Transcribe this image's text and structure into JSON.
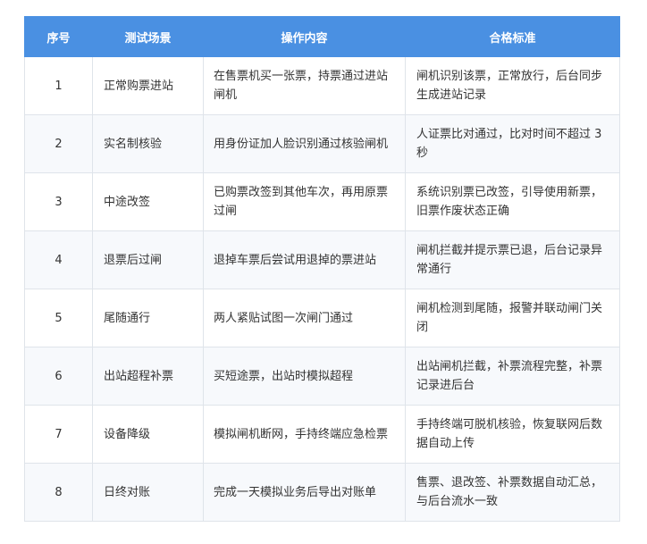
{
  "headers": [
    "序号",
    "测试场景",
    "操作内容",
    "合格标准"
  ],
  "rows": [
    {
      "no": "1",
      "scene": "正常购票进站",
      "op": "在售票机买一张票，持票通过进站闸机",
      "std": "闸机识别该票，正常放行，后台同步生成进站记录"
    },
    {
      "no": "2",
      "scene": "实名制核验",
      "op": "用身份证加人脸识别通过核验闸机",
      "std": "人证票比对通过，比对时间不超过 3 秒"
    },
    {
      "no": "3",
      "scene": "中途改签",
      "op": "已购票改签到其他车次，再用原票过闸",
      "std": "系统识别票已改签，引导使用新票，旧票作废状态正确"
    },
    {
      "no": "4",
      "scene": "退票后过闸",
      "op": "退掉车票后尝试用退掉的票进站",
      "std": "闸机拦截并提示票已退，后台记录异常通行"
    },
    {
      "no": "5",
      "scene": "尾随通行",
      "op": "两人紧贴试图一次闸门通过",
      "std": "闸机检测到尾随，报警并联动闸门关闭"
    },
    {
      "no": "6",
      "scene": "出站超程补票",
      "op": "买短途票，出站时模拟超程",
      "std": "出站闸机拦截，补票流程完整，补票记录进后台"
    },
    {
      "no": "7",
      "scene": "设备降级",
      "op": "模拟闸机断网，手持终端应急检票",
      "std": "手持终端可脱机核验，恢复联网后数据自动上传"
    },
    {
      "no": "8",
      "scene": "日终对账",
      "op": "完成一天模拟业务后导出对账单",
      "std": "售票、退改签、补票数据自动汇总，与后台流水一致"
    }
  ],
  "colors": {
    "header_bg": "#4a90e2",
    "header_text": "#ffffff",
    "border": "#dfe4ea",
    "alt_row": "#f7f9fc"
  }
}
